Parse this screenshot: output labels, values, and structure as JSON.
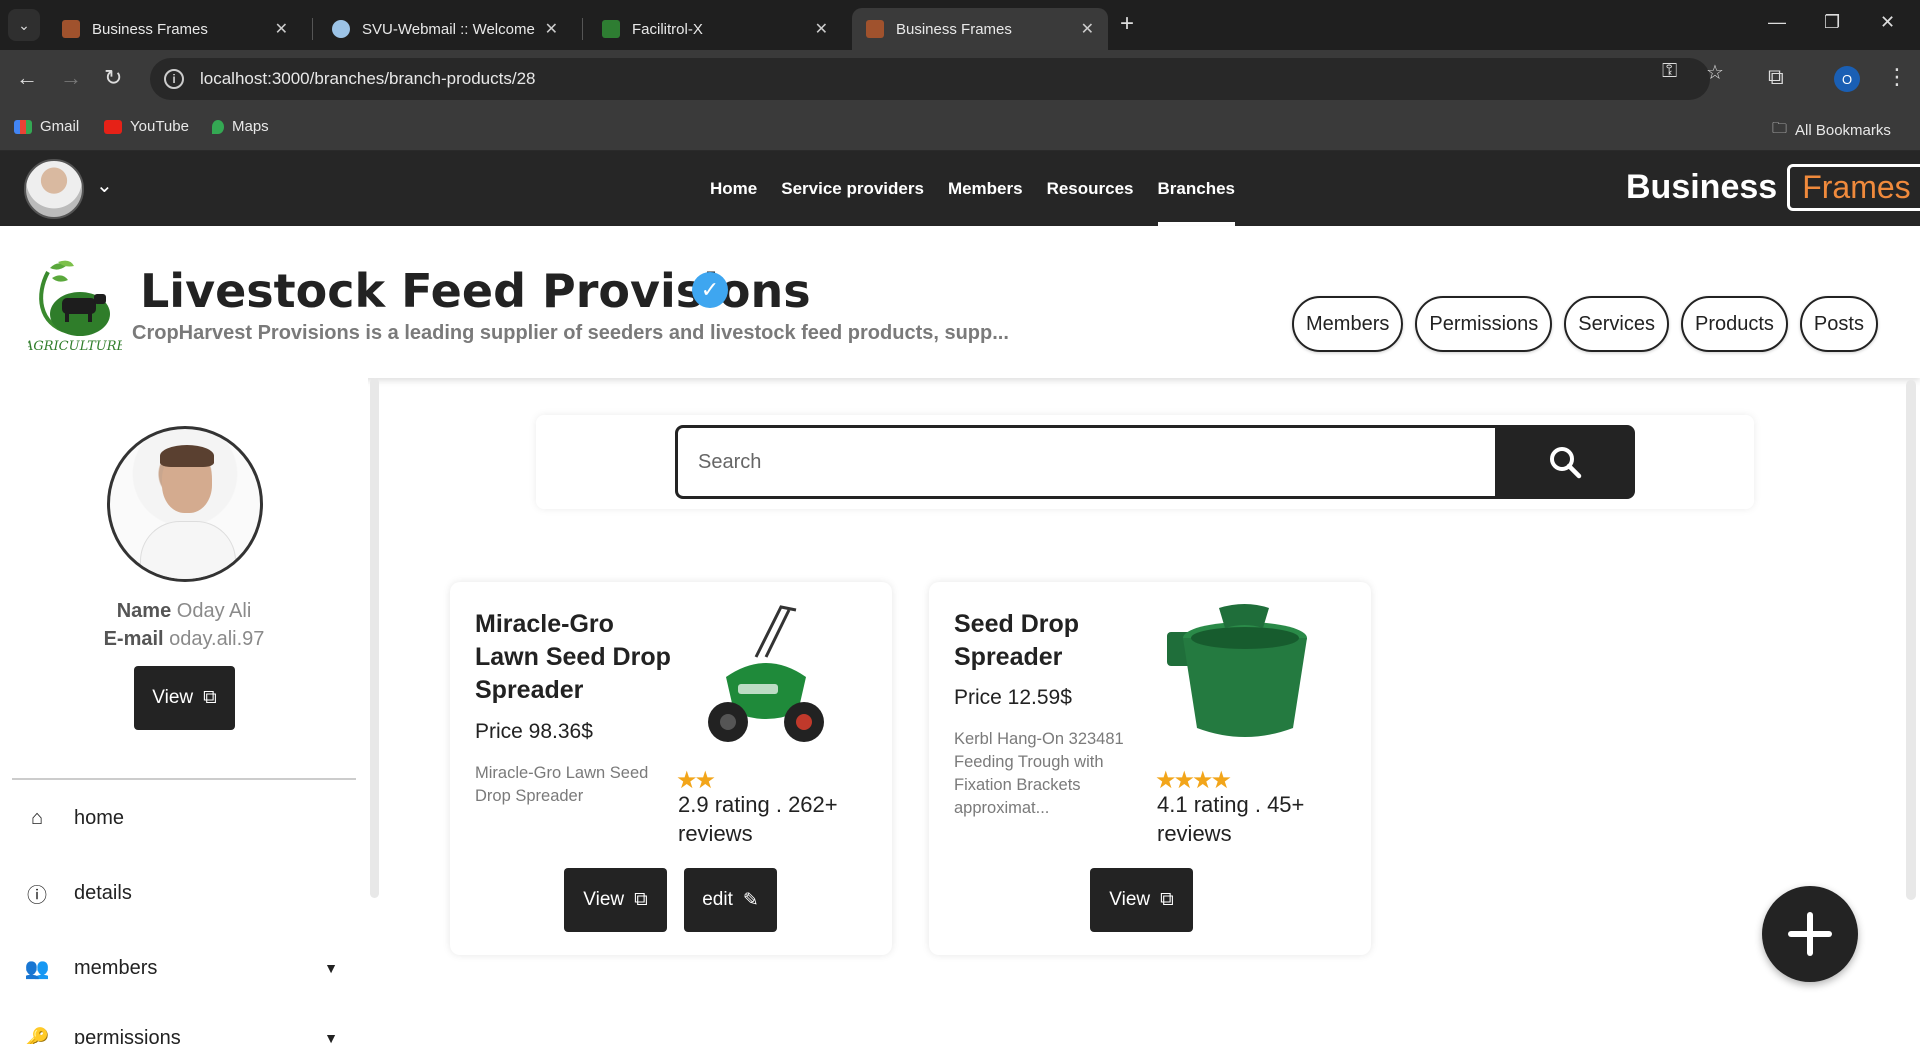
{
  "browser": {
    "tabs": [
      {
        "title": "Business Frames",
        "active": false
      },
      {
        "title": "SVU-Webmail :: Welcome",
        "active": false
      },
      {
        "title": "Facilitrol-X",
        "active": false
      },
      {
        "title": "Business Frames",
        "active": true
      }
    ],
    "url": "localhost:3000/branches/branch-products/28",
    "bookmarks": [
      "Gmail",
      "YouTube",
      "Maps"
    ],
    "all_bookmarks": "All Bookmarks",
    "profile_initial": "O"
  },
  "navbar": {
    "links": [
      "Home",
      "Service providers",
      "Members",
      "Resources",
      "Branches"
    ],
    "active_link": "Branches",
    "brand_part1": "Business",
    "brand_part2": "Frames",
    "brand_accent_color": "#f08a3c"
  },
  "branch": {
    "title": "Livestock Feed Provisions",
    "description": "CropHarvest Provisions is a leading supplier of seeders and livestock feed products, supp...",
    "logo_text": "AGRICULTURE",
    "verified_color": "#3ea6f0",
    "tabs": [
      "Members",
      "Permissions",
      "Services",
      "Products",
      "Posts"
    ]
  },
  "sidebar": {
    "name_label": "Name",
    "name_value": "Oday Ali",
    "email_label": "E-mail",
    "email_value": "oday.ali.97",
    "view_label": "View",
    "items": [
      {
        "label": "home",
        "icon": "home-icon"
      },
      {
        "label": "details",
        "icon": "info-icon"
      },
      {
        "label": "members",
        "icon": "users-icon"
      },
      {
        "label": "permissions",
        "icon": "key-icon"
      }
    ]
  },
  "search": {
    "placeholder": "Search"
  },
  "products": [
    {
      "name": "Miracle-Gro Lawn Seed Drop Spreader",
      "price": "Price 98.36$",
      "description": "Miracle-Gro Lawn Seed Drop Spreader",
      "stars": 2,
      "rating": "2.9 rating . 262+ reviews",
      "view_label": "View",
      "edit_label": "edit"
    },
    {
      "name": "Seed Drop Spreader",
      "price": "Price 12.59$",
      "description": "Kerbl Hang-On 323481 Feeding Trough with Fixation Brackets approximat...",
      "stars": 4,
      "rating": "4.1 rating . 45+ reviews",
      "view_label": "View"
    }
  ],
  "star_color": "#f2a51a"
}
